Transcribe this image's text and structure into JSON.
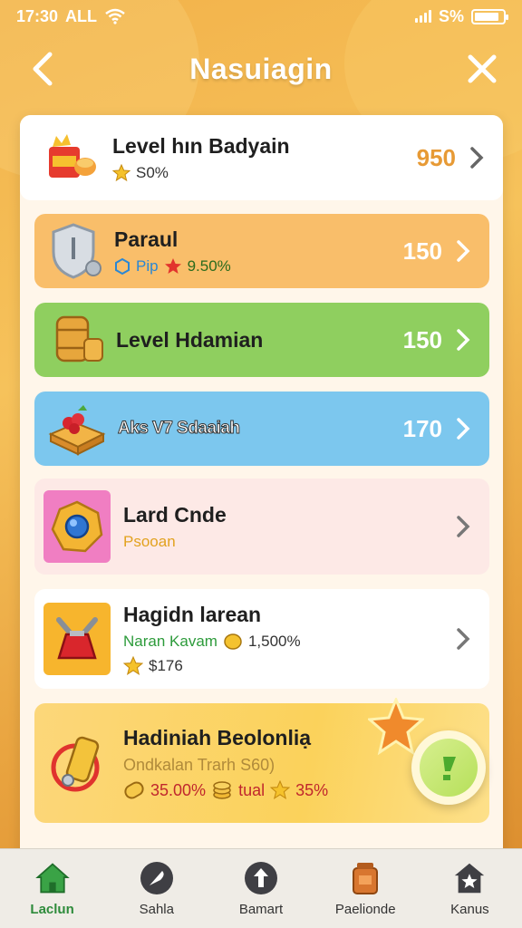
{
  "status_bar": {
    "time": "17:30",
    "carrier": "ALL",
    "battery_text": "S%",
    "battery_level": 0.85
  },
  "header": {
    "title": "Nasuiagin",
    "back_icon": "chevron-left-icon",
    "close_icon": "close-icon"
  },
  "cards": [
    {
      "name": "Level hın Badyain",
      "sub": "S0%",
      "points": "950",
      "icon": "gift-bag-icon"
    },
    {
      "name": "Paraul",
      "sub_a": "Pip",
      "sub_b": "9.50%",
      "points": "150",
      "icon": "shield-icon"
    },
    {
      "name": "Level Hdamian",
      "points": "150",
      "icon": "barrel-icon"
    },
    {
      "name": "Aks V7 Sdaaiah",
      "points": "170",
      "icon": "cake-icon"
    },
    {
      "name": "Lard Cnde",
      "sub": "Psooan",
      "icon": "gem-badge-icon"
    },
    {
      "name": "Hagidn larean",
      "sub_a": "Naran Kavam",
      "sub_b": "1,500%",
      "sub_c": "$176",
      "icon": "potion-icon"
    },
    {
      "name": "Hadiniah Beolonliạ",
      "sub": "Ondkalan Trarh S60)",
      "stat_a": "35.00%",
      "stat_b": "tual",
      "stat_c": "35%",
      "icon": "gadget-icon"
    }
  ],
  "fab": {
    "icon": "sticker-icon"
  },
  "tabs": [
    {
      "label": "Laclun",
      "icon": "home-icon",
      "active": true
    },
    {
      "label": "Sahla",
      "icon": "feather-icon",
      "active": false
    },
    {
      "label": "Bamart",
      "icon": "upload-icon",
      "active": false
    },
    {
      "label": "Paelionde",
      "icon": "jar-icon",
      "active": false
    },
    {
      "label": "Kanus",
      "icon": "house-star-icon",
      "active": false
    }
  ],
  "colors": {
    "accent": "#f2b24a",
    "card_orange": "#f9be6a",
    "card_green": "#8fcf5f",
    "card_blue": "#7cc7ee",
    "card_pink": "#fde9e6",
    "tab_active": "#2e8b3b"
  }
}
